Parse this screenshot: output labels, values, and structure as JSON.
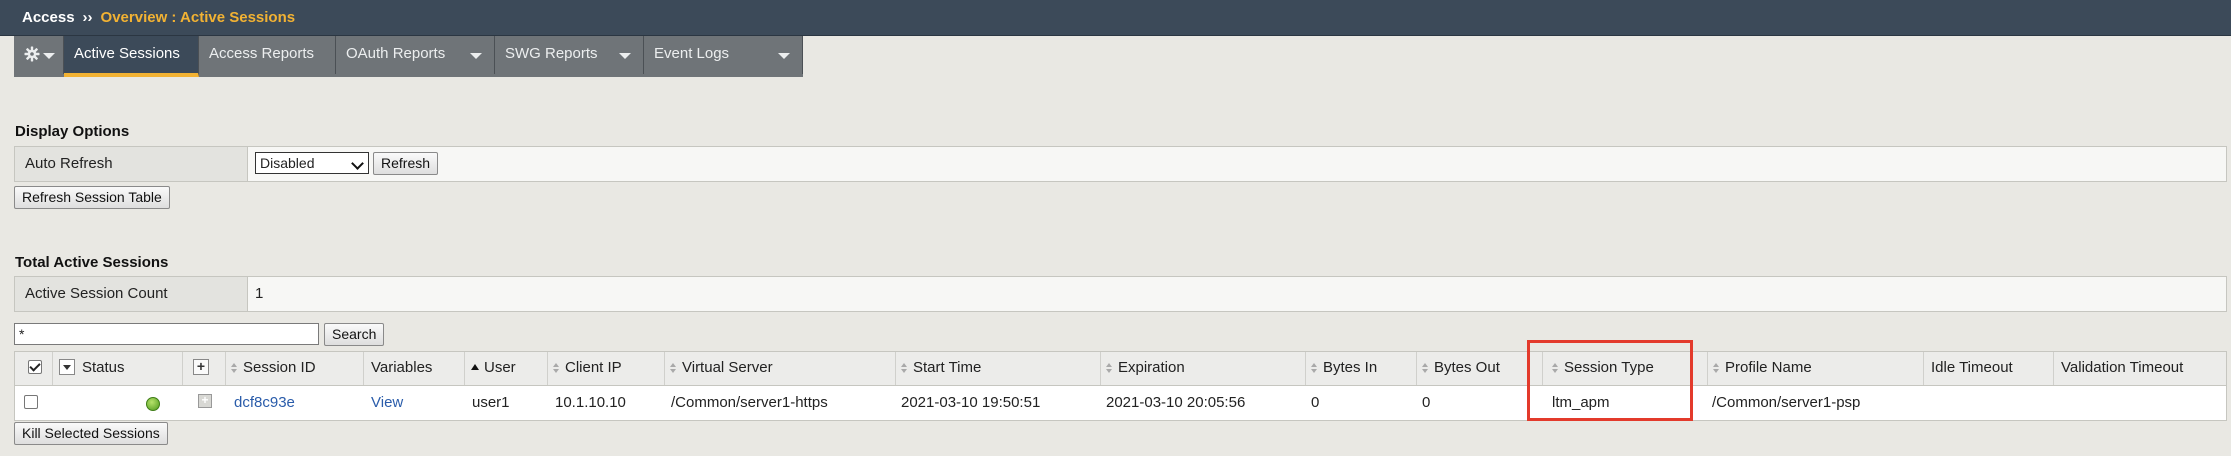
{
  "breadcrumb": {
    "root": "Access",
    "separator": "››",
    "current": "Overview : Active Sessions"
  },
  "tabs": [
    {
      "label": "Active Sessions",
      "active": true,
      "dropdown": false
    },
    {
      "label": "Access Reports",
      "active": false,
      "dropdown": false
    },
    {
      "label": "OAuth Reports",
      "active": false,
      "dropdown": true
    },
    {
      "label": "SWG Reports",
      "active": false,
      "dropdown": true
    },
    {
      "label": "Event Logs",
      "active": false,
      "dropdown": true
    }
  ],
  "display_options": {
    "title": "Display Options",
    "auto_refresh_label": "Auto Refresh",
    "auto_refresh_value": "Disabled",
    "refresh_button": "Refresh",
    "refresh_table_button": "Refresh Session Table"
  },
  "totals": {
    "title": "Total Active Sessions",
    "count_label": "Active Session Count",
    "count_value": "1"
  },
  "search": {
    "value": "*",
    "button": "Search"
  },
  "table": {
    "columns": {
      "status": "Status",
      "session_id": "Session ID",
      "variables": "Variables",
      "user": "User",
      "client_ip": "Client IP",
      "virtual_server": "Virtual Server",
      "start_time": "Start Time",
      "expiration": "Expiration",
      "bytes_in": "Bytes In",
      "bytes_out": "Bytes Out",
      "session_type": "Session Type",
      "profile_name": "Profile Name",
      "idle_timeout": "Idle Timeout",
      "validation_timeout": "Validation Timeout"
    },
    "rows": [
      {
        "session_id": "dcf8c93e",
        "variables": "View",
        "user": "user1",
        "client_ip": "10.1.10.10",
        "virtual_server": "/Common/server1-https",
        "start_time": "2021-03-10 19:50:51",
        "expiration": "2021-03-10 20:05:56",
        "bytes_in": "0",
        "bytes_out": "0",
        "session_type": "ltm_apm",
        "profile_name": "/Common/server1-psp",
        "idle_timeout": "",
        "validation_timeout": ""
      }
    ]
  },
  "kill_button": "Kill Selected Sessions",
  "colors": {
    "header_bg": "#3c4a59",
    "accent": "#f2b233",
    "highlight": "#e33a2b",
    "link": "#2a5caa"
  }
}
